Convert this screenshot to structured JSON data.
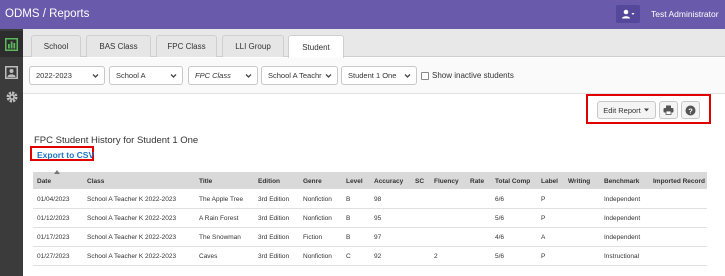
{
  "header": {
    "brand": "ODMS / Reports",
    "user_name": "Test Administrator"
  },
  "sidebar": {
    "items": [
      "dashboard-icon",
      "reports-icon",
      "settings-icon"
    ]
  },
  "tabs": [
    {
      "label": "School"
    },
    {
      "label": "BAS Class"
    },
    {
      "label": "FPC Class"
    },
    {
      "label": "LLI Group"
    },
    {
      "label": "Student"
    }
  ],
  "filters": {
    "year": "2022-2023",
    "school": "School A",
    "fpc_class": "FPC Class",
    "teacher": "School A Teachr",
    "student": "Student 1 One",
    "show_inactive_label": "Show inactive students"
  },
  "toolbar": {
    "edit_report": "Edit Report"
  },
  "report": {
    "title": "FPC Student History for Student 1 One",
    "export_label": "Export to CSV",
    "columns": [
      "Date",
      "Class",
      "Title",
      "Edition",
      "Genre",
      "Level",
      "Accuracy",
      "SC",
      "Fluency",
      "Rate",
      "Total Comp",
      "Label",
      "Writing",
      "Benchmark",
      "Imported Record"
    ],
    "rows": [
      [
        "01/04/2023",
        "School A Teacher K 2022-2023",
        "The Apple Tree",
        "3rd Edition",
        "Nonfiction",
        "B",
        "98",
        "",
        "",
        "",
        "6/6",
        "P",
        "",
        "Independent",
        ""
      ],
      [
        "01/12/2023",
        "School A Teacher K 2022-2023",
        "A Rain Forest",
        "3rd Edition",
        "Nonfiction",
        "B",
        "95",
        "",
        "",
        "",
        "5/6",
        "P",
        "",
        "Independent",
        ""
      ],
      [
        "01/17/2023",
        "School A Teacher K 2022-2023",
        "The Snowman",
        "3rd Edition",
        "Fiction",
        "B",
        "97",
        "",
        "",
        "",
        "4/6",
        "A",
        "",
        "Independent",
        ""
      ],
      [
        "01/27/2023",
        "School A Teacher K 2022-2023",
        "Caves",
        "3rd Edition",
        "Nonfiction",
        "C",
        "92",
        "",
        "2",
        "",
        "5/6",
        "P",
        "",
        "Instructional",
        ""
      ]
    ]
  },
  "colors": {
    "header_bg": "#6a5aab",
    "sidebar_bg": "#3b3b3b",
    "highlight": "#e00000",
    "link": "#1a76c5"
  }
}
